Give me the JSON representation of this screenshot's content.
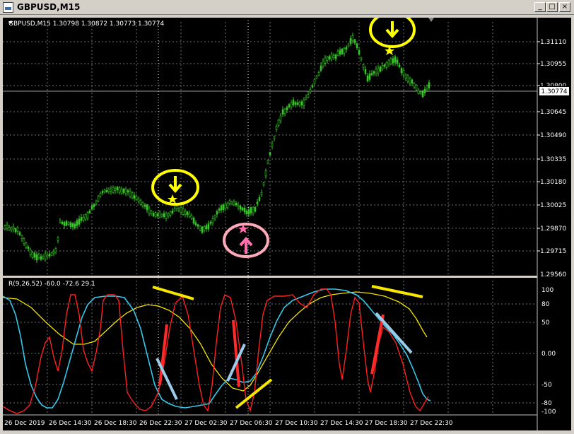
{
  "window": {
    "title": "GBPUSD,M15",
    "buttons": {
      "minimize": "_",
      "maximize": "□",
      "close": "×"
    }
  },
  "chart": {
    "header": "GBPUSD,M15  1.30798 1.30872 1.30773 1.30774",
    "current_price": "1.30774",
    "price_axis_labels": [
      "1.31110",
      "1.30955",
      "1.30800",
      "1.30645",
      "1.30490",
      "1.30335",
      "1.30180",
      "1.30025",
      "1.29870",
      "1.29715",
      "1.29560"
    ],
    "time_axis_labels": [
      "26 Dec 2019",
      "26 Dec 14:30",
      "26 Dec 18:30",
      "26 Dec 22:30",
      "27 Dec 02:30",
      "27 Dec 06:30",
      "27 Dec 10:30",
      "27 Dec 14:30",
      "27 Dec 18:30",
      "27 Dec 22:30"
    ],
    "colors": {
      "background": "#000000",
      "candles": "#34c724",
      "grid": "#6f6f6f"
    }
  },
  "indicator": {
    "header": "R(9,26,52) -60.0 -72.6 29.1",
    "axis_labels": [
      "100",
      "80",
      "50",
      "0.00",
      "-50",
      "-80",
      "-100"
    ],
    "series_colors": {
      "fast": "#ff1f1f",
      "mid": "#36c8ea",
      "slow": "#f4e400"
    }
  },
  "annotations": {
    "circle_color_sell": "#ffff00",
    "circle_color_buy": "#ffaabb",
    "stroke_red": "#ff2a2a",
    "stroke_blue": "#9ccbe8",
    "stroke_yellow": "#f7e600"
  }
}
